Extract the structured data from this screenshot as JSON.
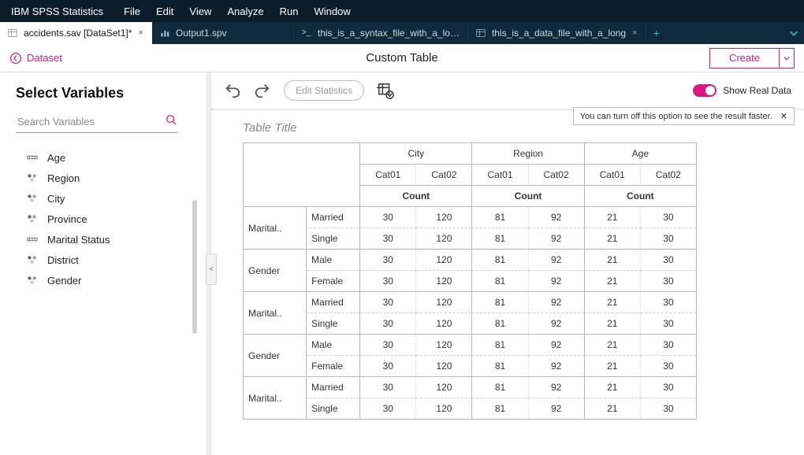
{
  "menubar": {
    "app": "IBM SPSS Statistics",
    "items": [
      "File",
      "Edit",
      "View",
      "Analyze",
      "Run",
      "Window"
    ]
  },
  "tabs": [
    {
      "label": "accidents.sav [DataSet1]*",
      "icon": "table",
      "active": true,
      "closable": true
    },
    {
      "label": "Output1.spv",
      "icon": "chart",
      "active": false,
      "closable": false
    },
    {
      "label": "this_is_a_syntax_file_with_a_lo…",
      "icon": "prompt",
      "active": false,
      "closable": false
    },
    {
      "label": "this_is_a_data_file_with_a_long",
      "icon": "table",
      "active": false,
      "closable": true
    }
  ],
  "header": {
    "back_label": "Dataset",
    "title": "Custom Table",
    "create_label": "Create"
  },
  "sidebar": {
    "title": "Select Variables",
    "search_placeholder": "Search Variables",
    "variables": [
      {
        "name": "Age",
        "type": "scale"
      },
      {
        "name": "Region",
        "type": "nominal"
      },
      {
        "name": "City",
        "type": "nominal"
      },
      {
        "name": "Province",
        "type": "nominal"
      },
      {
        "name": "Marital Status",
        "type": "scale"
      },
      {
        "name": "District",
        "type": "nominal"
      },
      {
        "name": "Gender",
        "type": "nominal"
      }
    ]
  },
  "toolbar": {
    "edit_stat": "Edit Statistics",
    "real_data_label": "Show Real Data",
    "tip_text": "You can turn off this option to see the result faster."
  },
  "table": {
    "title_placeholder": "Table Title",
    "col_groups": [
      "City",
      "Region",
      "Age"
    ],
    "col_cats": [
      "Cat01",
      "Cat02"
    ],
    "count_label": "Count",
    "row_groups": [
      {
        "label": "Marital..",
        "subs": [
          "Married",
          "Single"
        ]
      },
      {
        "label": "Gender",
        "subs": [
          "Male",
          "Female"
        ]
      },
      {
        "label": "Marital..",
        "subs": [
          "Married",
          "Single"
        ]
      },
      {
        "label": "Gender",
        "subs": [
          "Male",
          "Female"
        ]
      },
      {
        "label": "Marital..",
        "subs": [
          "Married",
          "Single"
        ]
      }
    ],
    "cell_row": [
      30,
      120,
      81,
      92,
      21,
      30
    ]
  }
}
